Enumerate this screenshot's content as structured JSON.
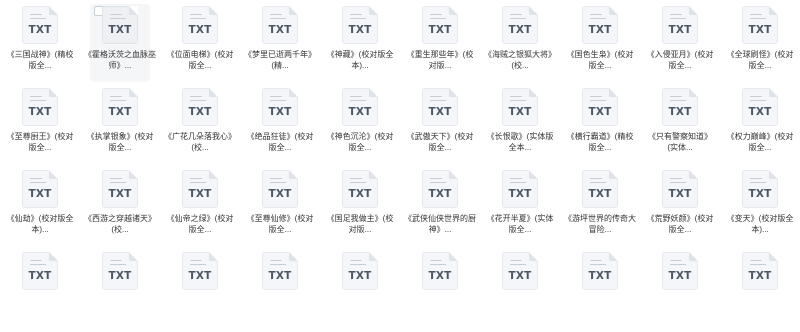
{
  "files": [
    {
      "name": "《三国战神》(精校版全...",
      "ext": "TXT"
    },
    {
      "name": "《霍格沃茨之血脉巫师》...",
      "ext": "TXT",
      "selected": true
    },
    {
      "name": "《位面电梯》(校对版全...",
      "ext": "TXT"
    },
    {
      "name": "《梦里已逝两千年》(精...",
      "ext": "TXT"
    },
    {
      "name": "《神藏》(校对版全本)...",
      "ext": "TXT"
    },
    {
      "name": "《重生那些年》(校对版...",
      "ext": "TXT"
    },
    {
      "name": "《海贼之银狐大将》(校...",
      "ext": "TXT"
    },
    {
      "name": "《国色生枭》(校对版全...",
      "ext": "TXT"
    },
    {
      "name": "《入侵亚月》(校对版全...",
      "ext": "TXT"
    },
    {
      "name": "《全球刷怪》(校对版全...",
      "ext": "TXT"
    },
    {
      "name": "《至尊厨王》(校对版全...",
      "ext": "TXT"
    },
    {
      "name": "《执掌银象》(校对版全...",
      "ext": "TXT"
    },
    {
      "name": "《广花几朵落我心》(校...",
      "ext": "TXT"
    },
    {
      "name": "《绝品狂徒》(校对版全...",
      "ext": "TXT"
    },
    {
      "name": "《神色沉沦》(校对版全...",
      "ext": "TXT"
    },
    {
      "name": "《武傲天下》(校对版全...",
      "ext": "TXT"
    },
    {
      "name": "《长恨歌》(实体版全本...",
      "ext": "TXT"
    },
    {
      "name": "《横行霸道》(精校版全...",
      "ext": "TXT"
    },
    {
      "name": "《只有警察知道》(实体...",
      "ext": "TXT"
    },
    {
      "name": "《权力巅峰》(校对版全...",
      "ext": "TXT"
    },
    {
      "name": "《仙劫》(校对版全本)...",
      "ext": "TXT"
    },
    {
      "name": "《西游之穿越诸天》(校...",
      "ext": "TXT"
    },
    {
      "name": "《仙帝之绿》(校对版全...",
      "ext": "TXT"
    },
    {
      "name": "《至尊仙修》(校对版全...",
      "ext": "TXT"
    },
    {
      "name": "《国足我做主》(校对版...",
      "ext": "TXT"
    },
    {
      "name": "《武侠仙侠世界的厨神》...",
      "ext": "TXT"
    },
    {
      "name": "《花开半夏》(实体版全...",
      "ext": "TXT"
    },
    {
      "name": "《游坪世界的传奇大冒险...",
      "ext": "TXT"
    },
    {
      "name": "《荒野妖颜》(校对版全...",
      "ext": "TXT"
    },
    {
      "name": "《变天》(校对版全本)...",
      "ext": "TXT"
    },
    {
      "name": "",
      "ext": "TXT"
    },
    {
      "name": "",
      "ext": "TXT"
    },
    {
      "name": "",
      "ext": "TXT"
    },
    {
      "name": "",
      "ext": "TXT"
    },
    {
      "name": "",
      "ext": "TXT"
    },
    {
      "name": "",
      "ext": "TXT"
    },
    {
      "name": "",
      "ext": "TXT"
    },
    {
      "name": "",
      "ext": "TXT"
    },
    {
      "name": "",
      "ext": "TXT"
    },
    {
      "name": "",
      "ext": "TXT"
    }
  ]
}
